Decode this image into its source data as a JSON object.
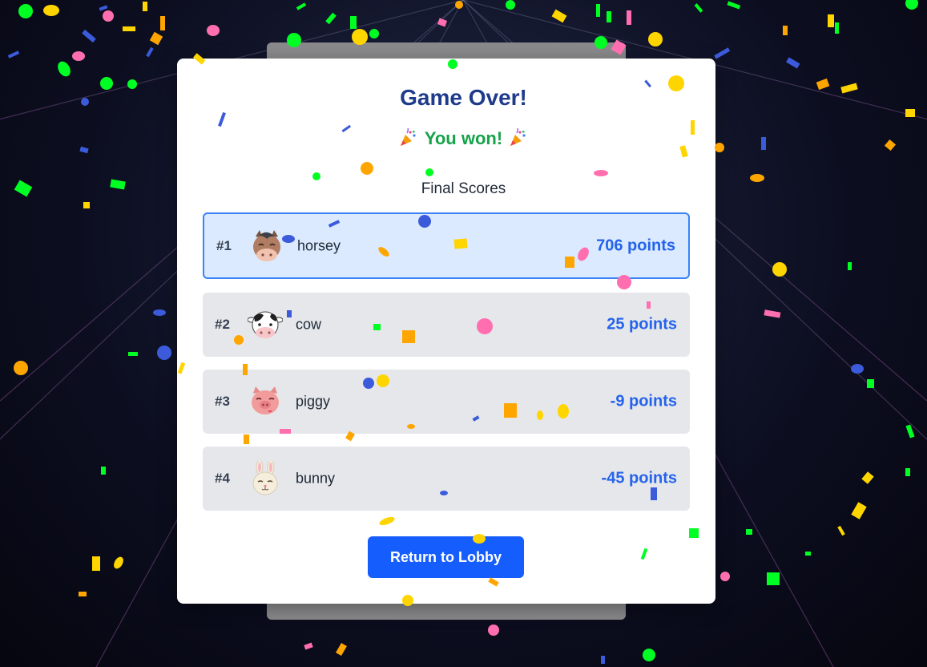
{
  "game": {
    "title": "Game Over!",
    "result_text": "You won!",
    "scores_heading": "Final Scores",
    "return_button_label": "Return to Lobby"
  },
  "players": [
    {
      "rank": "#1",
      "name": "horsey",
      "points": "706 points",
      "avatar": "horse-face-icon"
    },
    {
      "rank": "#2",
      "name": "cow",
      "points": "25 points",
      "avatar": "cow-face-icon"
    },
    {
      "rank": "#3",
      "name": "piggy",
      "points": "-9 points",
      "avatar": "pig-face-icon"
    },
    {
      "rank": "#4",
      "name": "bunny",
      "points": "-45 points",
      "avatar": "bunny-face-icon"
    }
  ],
  "colors": {
    "title": "#1e3a8a",
    "win": "#16a34a",
    "points": "#2563eb",
    "button": "#155dfc",
    "highlight_row": "#dbeafe",
    "highlight_border": "#3b82f6",
    "row": "#e5e7eb"
  }
}
